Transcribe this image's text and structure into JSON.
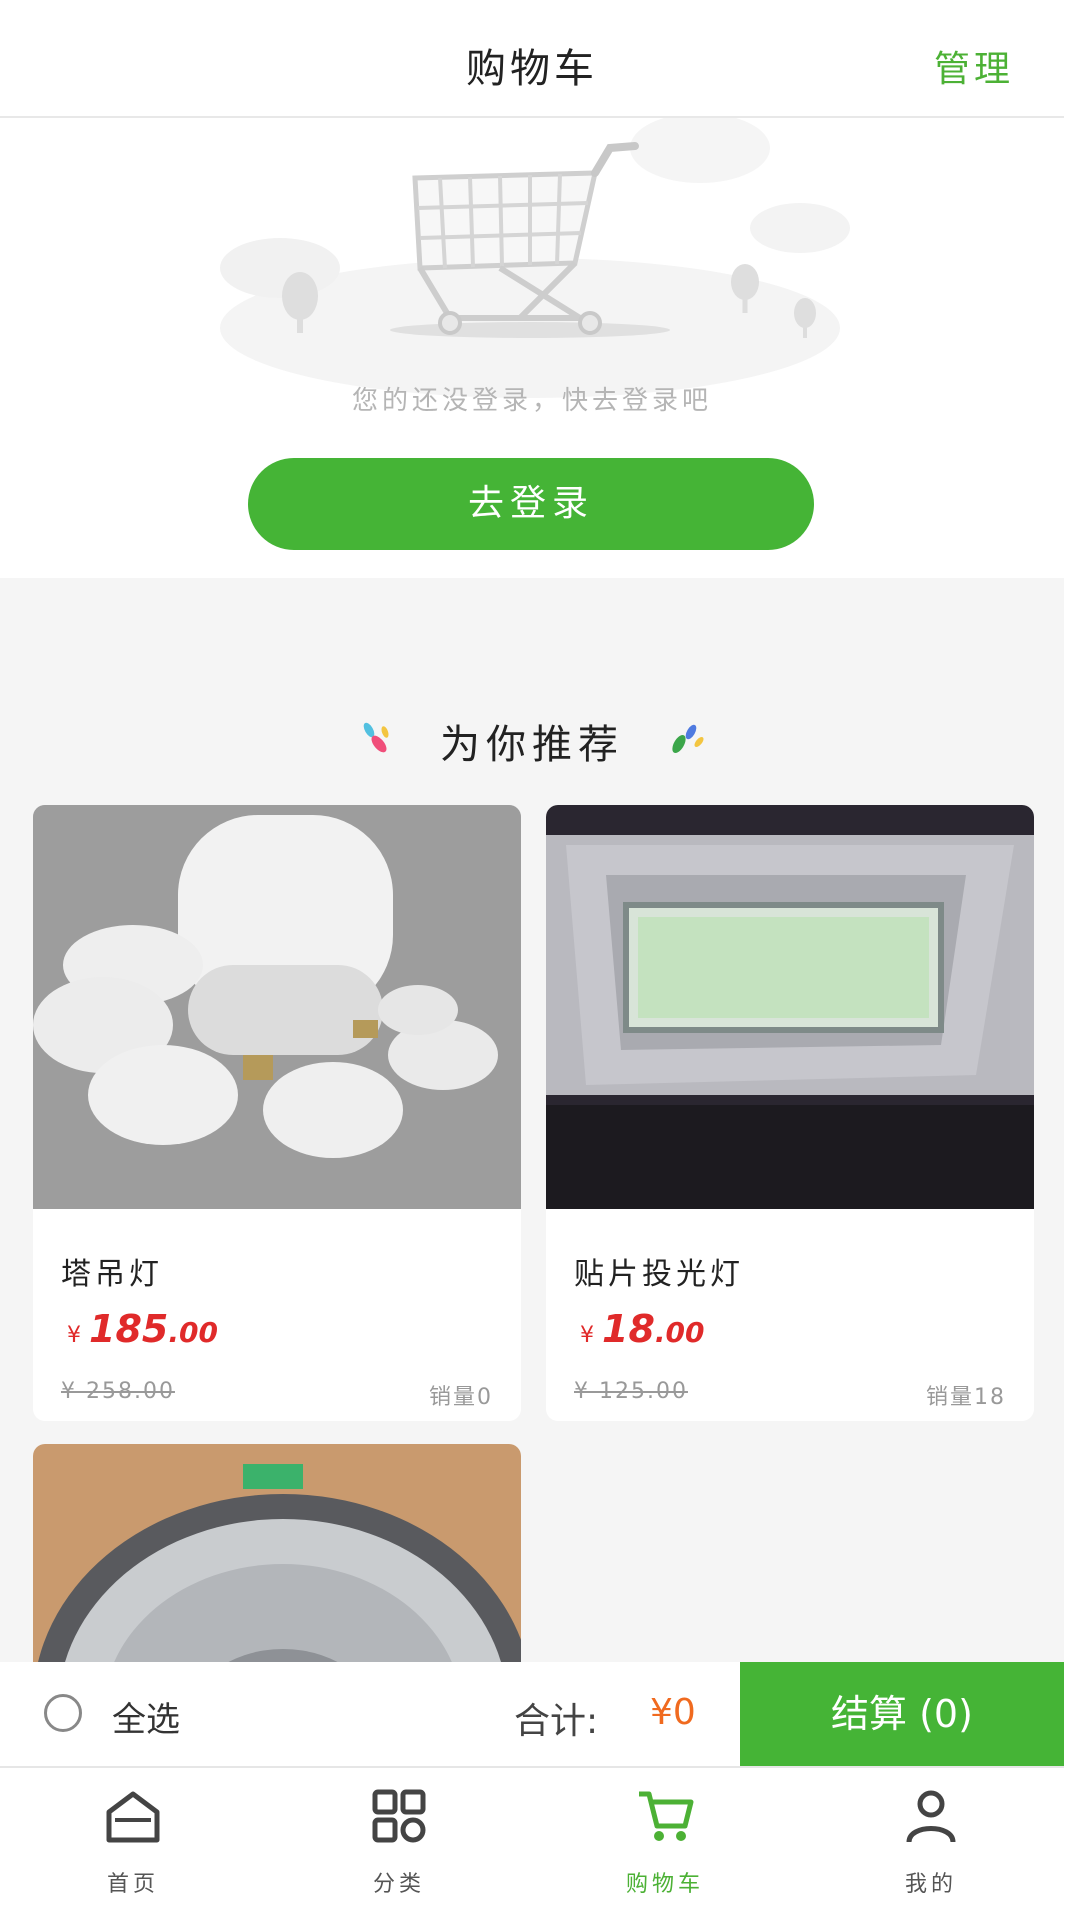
{
  "header": {
    "title": "购物车",
    "manage_label": "管理"
  },
  "login": {
    "tip": "您的还没登录，快去登录吧",
    "button_label": "去登录"
  },
  "recommend": {
    "title": "为你推荐",
    "products": [
      {
        "name": "塔吊灯",
        "price_symbol": "¥",
        "price_int": "185",
        "price_dec": ".00",
        "original_price": "¥ 258.00",
        "sales": "销量0"
      },
      {
        "name": "贴片投光灯",
        "price_symbol": "¥",
        "price_int": "18",
        "price_dec": ".00",
        "original_price": "¥ 125.00",
        "sales": "销量18"
      },
      {
        "name": ""
      }
    ]
  },
  "checkout": {
    "select_all_label": "全选",
    "total_label": "合计:",
    "total_value": "¥0",
    "button_label": "结算 (0)"
  },
  "tabbar": {
    "items": [
      {
        "label": "首页",
        "icon": "home-icon"
      },
      {
        "label": "分类",
        "icon": "category-icon"
      },
      {
        "label": "购物车",
        "icon": "cart-icon",
        "active": true
      },
      {
        "label": "我的",
        "icon": "user-icon"
      }
    ]
  },
  "colors": {
    "accent": "#45b436",
    "price": "#e02a2a",
    "total": "#f06a1f"
  }
}
